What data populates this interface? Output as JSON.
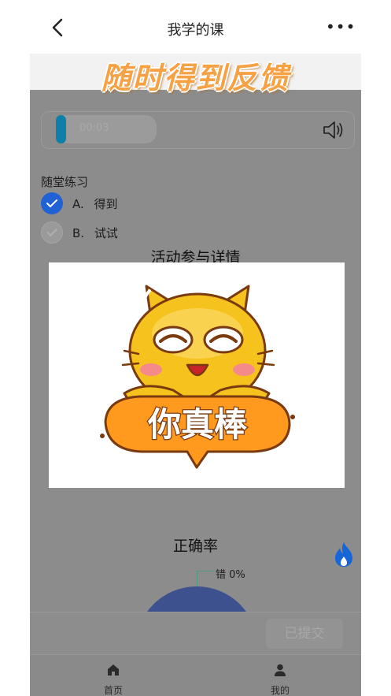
{
  "header": {
    "title": "我学的课",
    "more_label": "•••"
  },
  "banner": {
    "text": "随时得到反馈"
  },
  "audio": {
    "time": "00:03",
    "progress": 0.1
  },
  "quiz": {
    "section_label": "随堂练习",
    "options": [
      {
        "key": "A.",
        "text": "得到",
        "selected": true
      },
      {
        "key": "B.",
        "text": "试试",
        "selected": false
      }
    ]
  },
  "activity": {
    "title": "活动参与详情"
  },
  "popup": {
    "sticker_text": "你真棒"
  },
  "accuracy": {
    "title": "正确率",
    "wrong_label": "错 0%",
    "correct_color": "#3d518e"
  },
  "submit": {
    "label": "已提交"
  },
  "tabs": [
    {
      "label": "首页",
      "icon": "home-icon"
    },
    {
      "label": "我的",
      "icon": "user-icon"
    }
  ],
  "colors": {
    "accent": "#2161d6",
    "banner": "#f7a145",
    "flame": "#1666d8"
  }
}
